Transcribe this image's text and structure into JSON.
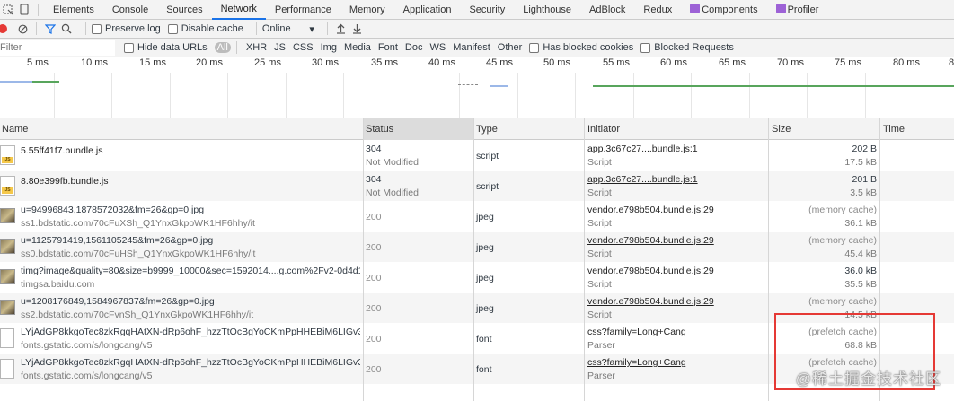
{
  "tabs": {
    "items": [
      "Elements",
      "Console",
      "Sources",
      "Network",
      "Performance",
      "Memory",
      "Application",
      "Security",
      "Lighthouse",
      "AdBlock",
      "Redux",
      "Components",
      "Profiler"
    ]
  },
  "toolbar": {
    "preserve_log": "Preserve log",
    "disable_cache": "Disable cache",
    "throttle": "Online"
  },
  "filterbar": {
    "placeholder": "Filter",
    "hide_data_urls": "Hide data URLs",
    "all": "All",
    "types": [
      "XHR",
      "JS",
      "CSS",
      "Img",
      "Media",
      "Font",
      "Doc",
      "WS",
      "Manifest",
      "Other"
    ],
    "has_blocked_cookies": "Has blocked cookies",
    "blocked_requests": "Blocked Requests"
  },
  "overview": {
    "ticks": [
      "5 ms",
      "10 ms",
      "15 ms",
      "20 ms",
      "25 ms",
      "30 ms",
      "35 ms",
      "40 ms",
      "45 ms",
      "50 ms",
      "55 ms",
      "60 ms",
      "65 ms",
      "70 ms",
      "75 ms",
      "80 ms",
      "8"
    ]
  },
  "table": {
    "columns": {
      "name": "Name",
      "status": "Status",
      "type": "Type",
      "initiator": "Initiator",
      "size": "Size",
      "time": "Time"
    },
    "rows": [
      {
        "icon": "js-file-icon",
        "name": "5.55ff41f7.bundle.js",
        "path": "",
        "status": "304",
        "status_text": "Not Modified",
        "type": "script",
        "initiator": "app.3c67c27....bundle.js:1",
        "initiator_type": "Script",
        "size1": "202 B",
        "size2": "17.5 kB"
      },
      {
        "icon": "js-file-icon",
        "name": "8.80e399fb.bundle.js",
        "path": "",
        "status": "304",
        "status_text": "Not Modified",
        "type": "script",
        "initiator": "app.3c67c27....bundle.js:1",
        "initiator_type": "Script",
        "size1": "201 B",
        "size2": "3.5 kB"
      },
      {
        "icon": "image-thumbnail",
        "name": "u=94996843,1878572032&fm=26&gp=0.jpg",
        "path": "ss1.bdstatic.com/70cFuXSh_Q1YnxGkpoWK1HF6hhy/it",
        "status": "200",
        "status_text": "",
        "type": "jpeg",
        "initiator": "vendor.e798b504.bundle.js:29",
        "initiator_type": "Script",
        "size1": "(memory cache)",
        "size2": "36.1 kB"
      },
      {
        "icon": "image-thumbnail",
        "name": "u=1125791419,1561105245&fm=26&gp=0.jpg",
        "path": "ss0.bdstatic.com/70cFuHSh_Q1YnxGkpoWK1HF6hhy/it",
        "status": "200",
        "status_text": "",
        "type": "jpeg",
        "initiator": "vendor.e798b504.bundle.js:29",
        "initiator_type": "Script",
        "size1": "(memory cache)",
        "size2": "45.4 kB"
      },
      {
        "icon": "image-thumbnail",
        "name": "timg?image&quality=80&size=b9999_10000&sec=1592014....g.com%2Fv2-0d4d1...",
        "path": "timgsa.baidu.com",
        "status": "200",
        "status_text": "",
        "type": "jpeg",
        "initiator": "vendor.e798b504.bundle.js:29",
        "initiator_type": "Script",
        "size1": "36.0 kB",
        "size2": "35.5 kB"
      },
      {
        "icon": "image-thumbnail",
        "name": "u=1208176849,1584967837&fm=26&gp=0.jpg",
        "path": "ss2.bdstatic.com/70cFvnSh_Q1YnxGkpoWK1HF6hhy/it",
        "status": "200",
        "status_text": "",
        "type": "jpeg",
        "initiator": "vendor.e798b504.bundle.js:29",
        "initiator_type": "Script",
        "size1": "(memory cache)",
        "size2": "14.5 kB"
      },
      {
        "icon": "document-icon",
        "name": "LYjAdGP8kkgoTec8zkRgqHAtXN-dRp6ohF_hzzTtOcBgYoCKmPpHHEBiM6LIGv3E...",
        "path": "fonts.gstatic.com/s/longcang/v5",
        "status": "200",
        "status_text": "",
        "type": "font",
        "initiator": "css?family=Long+Cang",
        "initiator_type": "Parser",
        "size1": "(prefetch cache)",
        "size2": "68.8 kB"
      },
      {
        "icon": "document-icon",
        "name": "LYjAdGP8kkgoTec8zkRgqHAtXN-dRp6ohF_hzzTtOcBgYoCKmPpHHEBiM6LIGv3E...",
        "path": "fonts.gstatic.com/s/longcang/v5",
        "status": "200",
        "status_text": "",
        "type": "font",
        "initiator": "css?family=Long+Cang",
        "initiator_type": "Parser",
        "size1": "(prefetch cache)",
        "size2": ""
      }
    ]
  },
  "watermark": "@稀土掘金技术社区"
}
